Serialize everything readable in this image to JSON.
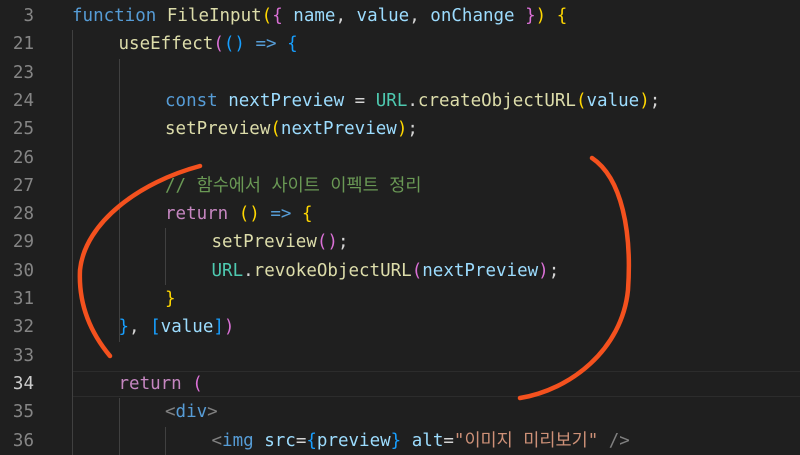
{
  "editor": {
    "current_line": "34",
    "lines": [
      {
        "num": "3",
        "indent": 0,
        "tokens": [
          {
            "t": "function",
            "c": "k-storage"
          },
          {
            "t": " ",
            "c": "plain"
          },
          {
            "t": "FileInput",
            "c": "fn"
          },
          {
            "t": "(",
            "c": "b1"
          },
          {
            "t": "{ ",
            "c": "b2"
          },
          {
            "t": "name",
            "c": "var"
          },
          {
            "t": ", ",
            "c": "plain"
          },
          {
            "t": "value",
            "c": "var"
          },
          {
            "t": ", ",
            "c": "plain"
          },
          {
            "t": "onChange",
            "c": "var"
          },
          {
            "t": " }",
            "c": "b2"
          },
          {
            "t": ")",
            "c": "b1"
          },
          {
            "t": " ",
            "c": "plain"
          },
          {
            "t": "{",
            "c": "b1"
          }
        ]
      },
      {
        "num": "21",
        "indent": 1,
        "tokens": [
          {
            "t": "useEffect",
            "c": "fn"
          },
          {
            "t": "(",
            "c": "b2"
          },
          {
            "t": "()",
            "c": "b3"
          },
          {
            "t": " ",
            "c": "plain"
          },
          {
            "t": "=>",
            "c": "k-storage"
          },
          {
            "t": " ",
            "c": "plain"
          },
          {
            "t": "{",
            "c": "b3"
          }
        ]
      },
      {
        "num": "23",
        "indent": 2,
        "tokens": []
      },
      {
        "num": "24",
        "indent": 2,
        "tokens": [
          {
            "t": "const",
            "c": "k-storage"
          },
          {
            "t": " ",
            "c": "plain"
          },
          {
            "t": "nextPreview",
            "c": "var"
          },
          {
            "t": " = ",
            "c": "plain"
          },
          {
            "t": "URL",
            "c": "cls"
          },
          {
            "t": ".",
            "c": "plain"
          },
          {
            "t": "createObjectURL",
            "c": "fn"
          },
          {
            "t": "(",
            "c": "b1"
          },
          {
            "t": "value",
            "c": "var"
          },
          {
            "t": ")",
            "c": "b1"
          },
          {
            "t": ";",
            "c": "plain"
          }
        ]
      },
      {
        "num": "25",
        "indent": 2,
        "tokens": [
          {
            "t": "setPreview",
            "c": "fn"
          },
          {
            "t": "(",
            "c": "b1"
          },
          {
            "t": "nextPreview",
            "c": "var"
          },
          {
            "t": ")",
            "c": "b1"
          },
          {
            "t": ";",
            "c": "plain"
          }
        ]
      },
      {
        "num": "26",
        "indent": 2,
        "tokens": []
      },
      {
        "num": "27",
        "indent": 2,
        "tokens": [
          {
            "t": "// 함수에서 사이트 이펙트 정리",
            "c": "cmt"
          }
        ]
      },
      {
        "num": "28",
        "indent": 2,
        "tokens": [
          {
            "t": "return",
            "c": "k-ctrl"
          },
          {
            "t": " ",
            "c": "plain"
          },
          {
            "t": "()",
            "c": "b1"
          },
          {
            "t": " ",
            "c": "plain"
          },
          {
            "t": "=>",
            "c": "k-storage"
          },
          {
            "t": " ",
            "c": "plain"
          },
          {
            "t": "{",
            "c": "b1"
          }
        ]
      },
      {
        "num": "29",
        "indent": 3,
        "tokens": [
          {
            "t": "setPreview",
            "c": "fn"
          },
          {
            "t": "()",
            "c": "b2"
          },
          {
            "t": ";",
            "c": "plain"
          }
        ]
      },
      {
        "num": "30",
        "indent": 3,
        "tokens": [
          {
            "t": "URL",
            "c": "cls"
          },
          {
            "t": ".",
            "c": "plain"
          },
          {
            "t": "revokeObjectURL",
            "c": "fn"
          },
          {
            "t": "(",
            "c": "b2"
          },
          {
            "t": "nextPreview",
            "c": "var"
          },
          {
            "t": ")",
            "c": "b2"
          },
          {
            "t": ";",
            "c": "plain"
          }
        ]
      },
      {
        "num": "31",
        "indent": 2,
        "tokens": [
          {
            "t": "}",
            "c": "b1"
          }
        ]
      },
      {
        "num": "32",
        "indent": 1,
        "tokens": [
          {
            "t": "}",
            "c": "b3"
          },
          {
            "t": ", ",
            "c": "plain"
          },
          {
            "t": "[",
            "c": "b3"
          },
          {
            "t": "value",
            "c": "var"
          },
          {
            "t": "]",
            "c": "b3"
          },
          {
            "t": ")",
            "c": "b2"
          }
        ]
      },
      {
        "num": "33",
        "indent": 1,
        "tokens": []
      },
      {
        "num": "34",
        "indent": 1,
        "tokens": [
          {
            "t": "return",
            "c": "k-ctrl"
          },
          {
            "t": " ",
            "c": "plain"
          },
          {
            "t": "(",
            "c": "b2"
          }
        ]
      },
      {
        "num": "35",
        "indent": 2,
        "tokens": [
          {
            "t": "<",
            "c": "tag"
          },
          {
            "t": "div",
            "c": "tagname"
          },
          {
            "t": ">",
            "c": "tag"
          }
        ]
      },
      {
        "num": "36",
        "indent": 3,
        "tokens": [
          {
            "t": "<",
            "c": "tag"
          },
          {
            "t": "img",
            "c": "tagname"
          },
          {
            "t": " ",
            "c": "plain"
          },
          {
            "t": "src",
            "c": "var"
          },
          {
            "t": "=",
            "c": "plain"
          },
          {
            "t": "{",
            "c": "b3"
          },
          {
            "t": "preview",
            "c": "var"
          },
          {
            "t": "}",
            "c": "b3"
          },
          {
            "t": " ",
            "c": "plain"
          },
          {
            "t": "alt",
            "c": "var"
          },
          {
            "t": "=",
            "c": "plain"
          },
          {
            "t": "\"이미지 미리보기\"",
            "c": "str"
          },
          {
            "t": " />",
            "c": "tag"
          }
        ]
      }
    ]
  },
  "annotation": {
    "color": "#f4511e",
    "icon": "hand-drawn-curly-brace"
  }
}
